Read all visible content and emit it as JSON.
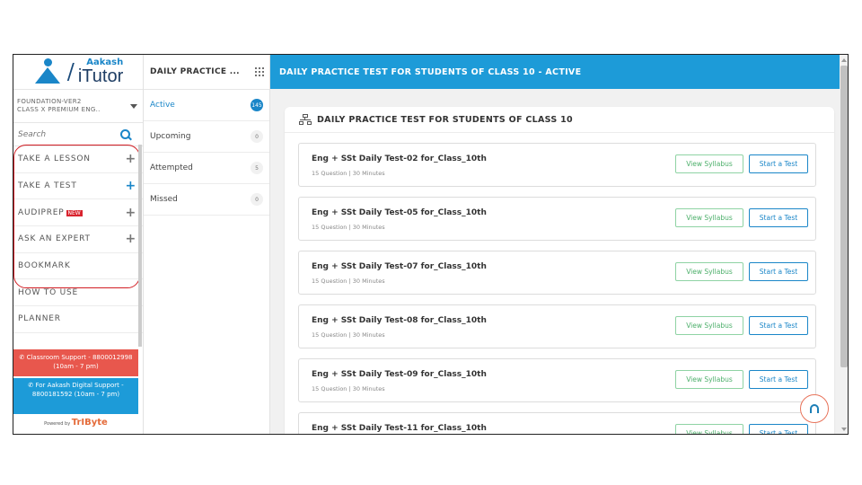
{
  "logo": {
    "brand": "Aakash",
    "product": "iTutor",
    "slash": "/"
  },
  "course": {
    "line1": "FOUNDATION-VER2",
    "line2": "CLASS X PREMIUM ENG.."
  },
  "search": {
    "placeholder": "Search"
  },
  "menu": [
    {
      "label": "TAKE A LESSON",
      "action": "+"
    },
    {
      "label": "TAKE A TEST",
      "action": "+"
    },
    {
      "label": "AUDIPREP",
      "badge": "NEW",
      "action": "+"
    },
    {
      "label": "ASK AN EXPERT",
      "action": "+"
    },
    {
      "label": "BOOKMARK"
    },
    {
      "label": "HOW TO USE"
    },
    {
      "label": "PLANNER"
    }
  ],
  "support": {
    "classroom": "Classroom Support - 8800012998 (10am - 7 pm)",
    "digital": "For Aakash Digital Support - 8800181592 (10am - 7 pm)",
    "powered_prefix": "Powered by",
    "powered_brand": "TrIByte"
  },
  "status_panel": {
    "title": "DAILY PRACTICE ...",
    "rows": [
      {
        "label": "Active",
        "count": "145"
      },
      {
        "label": "Upcoming",
        "count": "0"
      },
      {
        "label": "Attempted",
        "count": "5"
      },
      {
        "label": "Missed",
        "count": "0"
      }
    ]
  },
  "main": {
    "topbar_title": "DAILY PRACTICE TEST FOR STUDENTS OF CLASS 10 - ACTIVE",
    "card_title": "DAILY PRACTICE TEST FOR STUDENTS OF CLASS 10",
    "view_label": "View Syllabus",
    "start_label": "Start a Test",
    "tests": [
      {
        "name": "Eng + SSt Daily Test-02 for_Class_10th",
        "meta": "15 Question | 30 Minutes"
      },
      {
        "name": "Eng + SSt Daily Test-05 for_Class_10th",
        "meta": "15 Question | 30 Minutes"
      },
      {
        "name": "Eng + SSt Daily Test-07 for_Class_10th",
        "meta": "15 Question | 30 Minutes"
      },
      {
        "name": "Eng + SSt Daily Test-08 for_Class_10th",
        "meta": "15 Question | 30 Minutes"
      },
      {
        "name": "Eng + SSt Daily Test-09 for_Class_10th",
        "meta": "15 Question | 30 Minutes"
      },
      {
        "name": "Eng + SSt Daily Test-11 for_Class_10th",
        "meta": ""
      }
    ]
  },
  "colors": {
    "accent": "#1d9bd8",
    "highlight": "#d21e24",
    "syllabus": "#4caf6a",
    "support_red": "#e8574d"
  }
}
